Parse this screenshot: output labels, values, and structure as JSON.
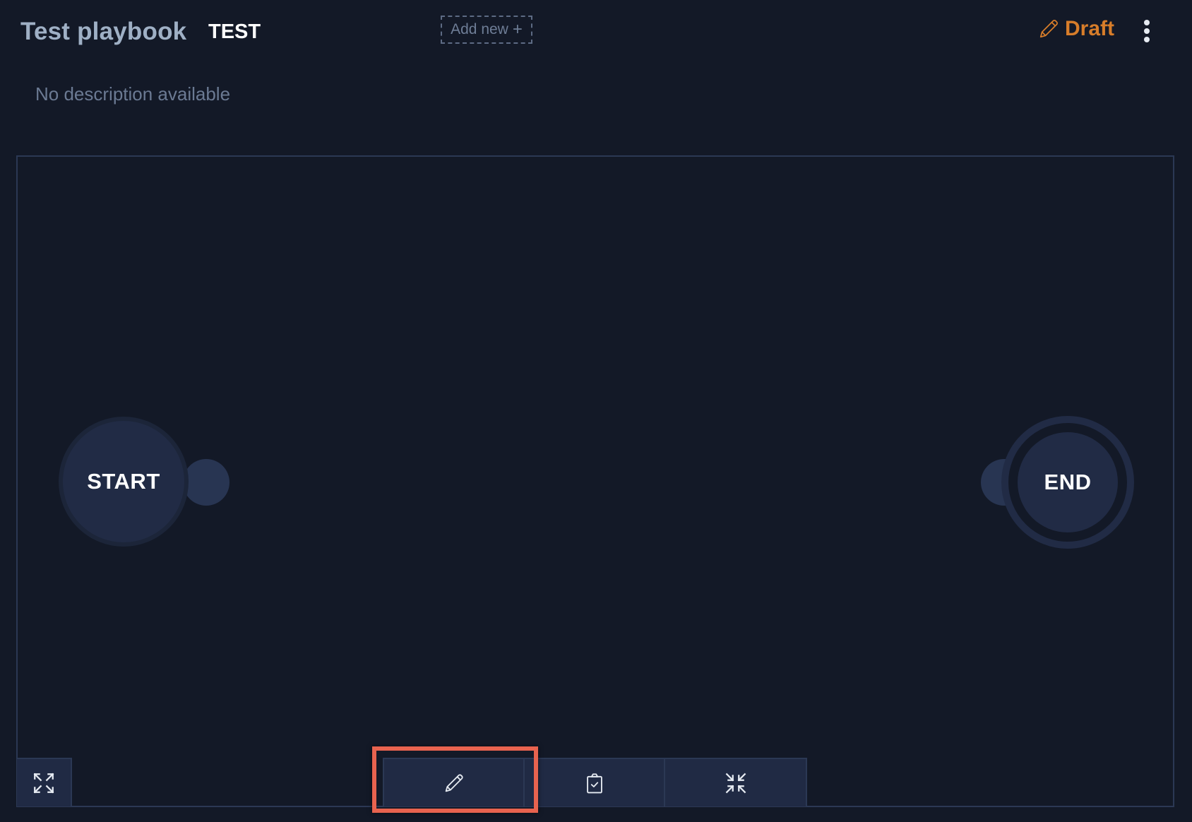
{
  "header": {
    "title": "Test playbook",
    "tag": "TEST",
    "add_new_label": "Add new",
    "add_new_icon": "plus-icon",
    "status_label": "Draft",
    "status_icon": "pencil-icon",
    "status_color": "#d77d2a",
    "menu_icon": "kebab-menu-icon"
  },
  "description": "No description available",
  "canvas": {
    "nodes": [
      {
        "id": "start",
        "label": "START"
      },
      {
        "id": "end",
        "label": "END"
      }
    ]
  },
  "controls": {
    "fullscreen_icon": "expand-icon",
    "toolbar": [
      {
        "id": "edit",
        "icon": "pencil-icon",
        "highlighted": true
      },
      {
        "id": "validate",
        "icon": "clipboard-check-icon",
        "highlighted": false
      },
      {
        "id": "collapse",
        "icon": "collapse-icon",
        "highlighted": false
      }
    ]
  },
  "colors": {
    "background": "#131927",
    "node": "#212b45",
    "border": "#2b3854",
    "highlight": "#e8634f",
    "accent": "#d77d2a"
  }
}
